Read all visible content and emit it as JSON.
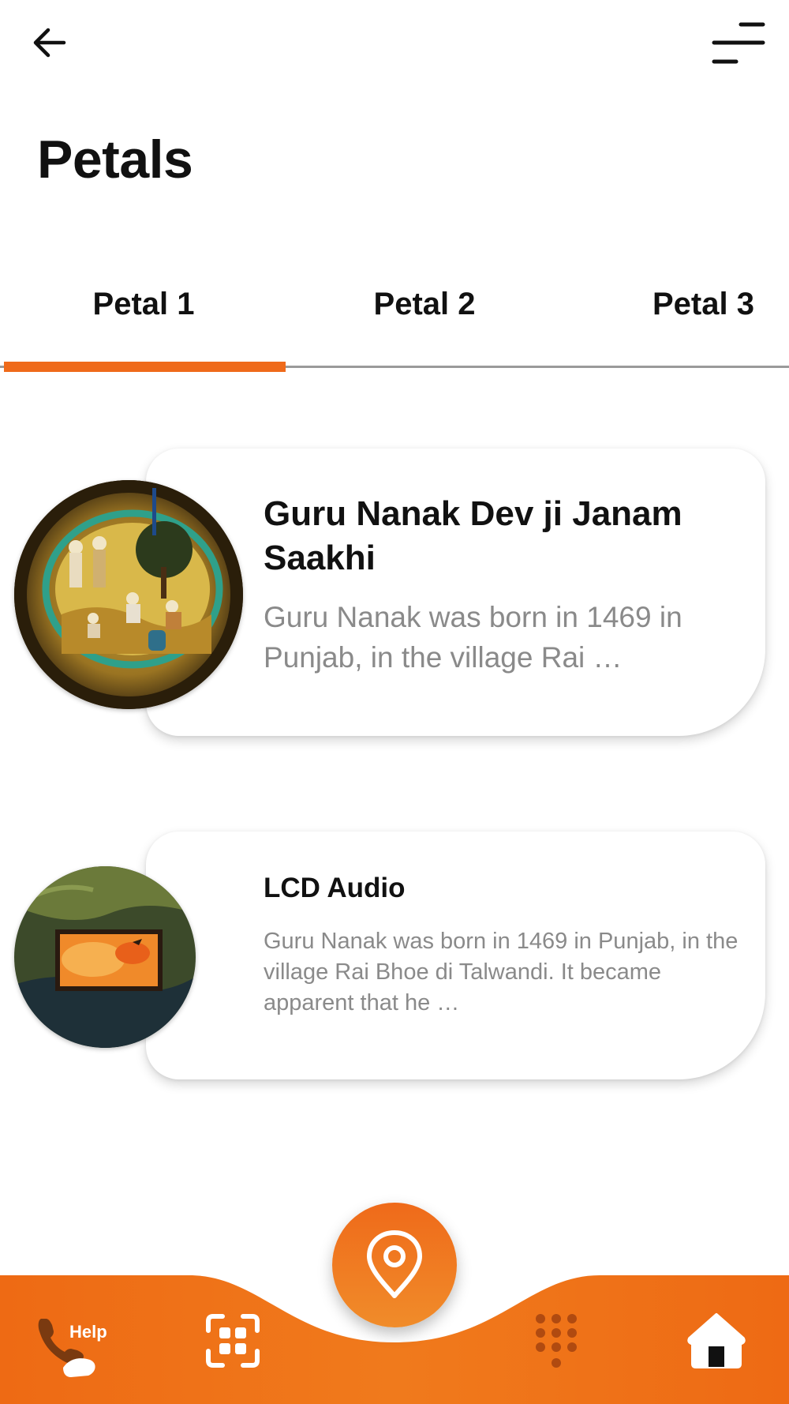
{
  "header": {
    "back_icon": "arrow-left-icon",
    "menu_icon": "filter-lines-icon",
    "title": "Petals"
  },
  "tabs": [
    {
      "label": "Petal 1",
      "selected": true
    },
    {
      "label": "Petal 2",
      "selected": false
    },
    {
      "label": "Petal 3",
      "selected": false
    }
  ],
  "cards": [
    {
      "title": "Guru Nanak Dev ji Janam Saakhi",
      "description": "Guru Nanak was born in 1469 in Punjab, in the village Rai …",
      "thumbnail": "painting-thumbnail"
    },
    {
      "title": "LCD Audio",
      "description": "Guru Nanak was born in 1469 in Punjab, in the village Rai Bhoe di Talwandi. It became apparent that he …",
      "thumbnail": "lcd-screen-thumbnail"
    }
  ],
  "bottom_nav": {
    "help_label": "Help",
    "help_icon": "phone-hand-icon",
    "scan_icon": "qr-scan-icon",
    "fab_icon": "location-pin-icon",
    "dialpad_icon": "dialpad-icon",
    "home_icon": "home-icon"
  },
  "colors": {
    "accent": "#ef6a1a",
    "accent_light": "#f08c2a",
    "muted_text": "#8a8a8a",
    "dialpad": "#b04a10"
  }
}
